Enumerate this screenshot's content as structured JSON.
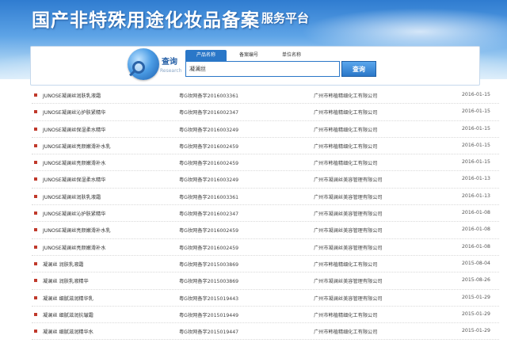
{
  "header": {
    "title": "国产非特殊用途化妆品备案",
    "subtitle": "服务平台"
  },
  "search": {
    "label": "查询",
    "label_en": "Research",
    "tabs": [
      {
        "label": "产品名称",
        "active": true
      },
      {
        "label": "备案编号",
        "active": false
      },
      {
        "label": "单位名称",
        "active": false
      }
    ],
    "input_value": "凝澜丝",
    "button_label": "查询"
  },
  "results": [
    {
      "name": "JUNOSE凝澜丝润肤乳液霜",
      "reg": "粤G妆网备字2016003361",
      "company": "广州市韩植精细化工有限公司",
      "date": "2016-01-15"
    },
    {
      "name": "JUNOSE凝澜丝沁护肤紧精华",
      "reg": "粤G妆网备字2016002347",
      "company": "广州市韩植精细化工有限公司",
      "date": "2016-01-15"
    },
    {
      "name": "JUNOSE凝澜丝保湿柔水精华",
      "reg": "粤G妆网备字2016003249",
      "company": "广州市韩植精细化工有限公司",
      "date": "2016-01-15"
    },
    {
      "name": "JUNOSE凝澜丝亮颜嫩滑补水乳",
      "reg": "粤G妆网备字2016002459",
      "company": "广州市韩植精细化工有限公司",
      "date": "2016-01-15"
    },
    {
      "name": "JUNOSE凝澜丝亮颜嫩滑补水",
      "reg": "粤G妆网备字2016002459",
      "company": "广州市韩植精细化工有限公司",
      "date": "2016-01-15"
    },
    {
      "name": "JUNOSE凝澜丝保湿柔水精华",
      "reg": "粤G妆网备字2016003249",
      "company": "广州市凝澜丝美容管理有限公司",
      "date": "2016-01-13"
    },
    {
      "name": "JUNOSE凝澜丝润肤乳液霜",
      "reg": "粤G妆网备字2016003361",
      "company": "广州市凝澜丝美容管理有限公司",
      "date": "2016-01-13"
    },
    {
      "name": "JUNOSE凝澜丝沁护肤紧精华",
      "reg": "粤G妆网备字2016002347",
      "company": "广州市凝澜丝美容管理有限公司",
      "date": "2016-01-08"
    },
    {
      "name": "JUNOSE凝澜丝亮颜嫩滑补水乳",
      "reg": "粤G妆网备字2016002459",
      "company": "广州市凝澜丝美容管理有限公司",
      "date": "2016-01-08"
    },
    {
      "name": "JUNOSE凝澜丝亮颜嫩滑补水",
      "reg": "粤G妆网备字2016002459",
      "company": "广州市凝澜丝美容管理有限公司",
      "date": "2016-01-08"
    },
    {
      "name": "凝澜丝 润肤乳液霜",
      "reg": "粤G妆网备字2015003869",
      "company": "广州市韩植精细化工有限公司",
      "date": "2015-08-04"
    },
    {
      "name": "凝澜丝 润肤乳液精华",
      "reg": "粤G妆网备字2015003869",
      "company": "广州市凝澜丝美容管理有限公司",
      "date": "2015-08-26"
    },
    {
      "name": "凝澜丝 细腻滋润精华乳",
      "reg": "粤G妆网备字2015019443",
      "company": "广州市凝澜丝美容管理有限公司",
      "date": "2015-01-29"
    },
    {
      "name": "凝澜丝 细腻滋润抗皱霜",
      "reg": "粤G妆网备字2015019449",
      "company": "广州市韩植精细化工有限公司",
      "date": "2015-01-29"
    },
    {
      "name": "凝澜丝 细腻滋润精华水",
      "reg": "粤G妆网备字2015019447",
      "company": "广州市韩植精细化工有限公司",
      "date": "2015-01-29"
    }
  ]
}
